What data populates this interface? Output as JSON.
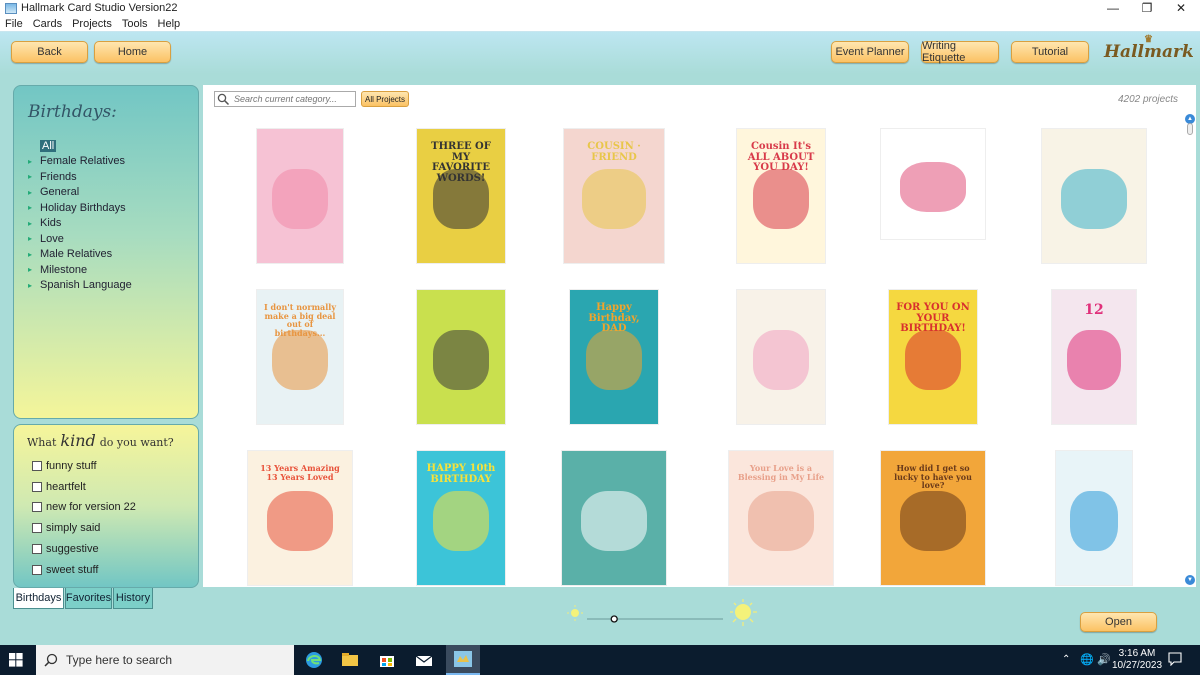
{
  "window": {
    "title": "Hallmark Card Studio Version22",
    "controls": {
      "minimize": "—",
      "maximize": "❐",
      "close": "✕"
    }
  },
  "menu": [
    "File",
    "Cards",
    "Projects",
    "Tools",
    "Help"
  ],
  "toolbar": {
    "back": "Back",
    "home": "Home",
    "event_planner": "Event Planner",
    "writing_etiquette": "Writing Etiquette",
    "tutorial": "Tutorial",
    "logo": "Hallmark"
  },
  "categories": {
    "title": "Birthdays:",
    "items": [
      "All",
      "Female Relatives",
      "Friends",
      "General",
      "Holiday Birthdays",
      "Kids",
      "Love",
      "Male Relatives",
      "Milestone",
      "Spanish Language"
    ],
    "selected": "All"
  },
  "kind": {
    "prefix": "What",
    "word": "kind",
    "suffix": "do you want?",
    "options": [
      "funny stuff",
      "heartfelt",
      "new for version 22",
      "simply said",
      "suggestive",
      "sweet stuff"
    ]
  },
  "left_tabs": [
    "Birthdays",
    "Favorites",
    "History"
  ],
  "main": {
    "search_placeholder": "Search current category...",
    "all_projects": "All Projects",
    "count_label": "4202  projects"
  },
  "cards": [
    {
      "text": "",
      "bg": "#f6c2d4",
      "accent": "#f08aa8"
    },
    {
      "text": "THREE OF MY FAVORITE WORDS!",
      "bg": "#e9cf43",
      "accent": "#333333"
    },
    {
      "text": "COUSIN · FRIEND",
      "bg": "#f4d6cf",
      "accent": "#e8c64a"
    },
    {
      "text": "Cousin It's ALL ABOUT YOU DAY!",
      "bg": "#fff6dc",
      "accent": "#d83a4a"
    },
    {
      "text": "",
      "bg": "#ffffff",
      "accent": "#e0507a"
    },
    {
      "text": "",
      "bg": "#f8f3e6",
      "accent": "#3ab0c8"
    },
    {
      "text": "I don't normally make a big deal out of birthdays...",
      "bg": "#e8f2f4",
      "accent": "#e89540"
    },
    {
      "text": "",
      "bg": "#c9e04e",
      "accent": "#3a3a3a"
    },
    {
      "text": "Happy Birthday, DAD",
      "bg": "#2aa6b0",
      "accent": "#f1a42b"
    },
    {
      "text": "",
      "bg": "#f8f2e8",
      "accent": "#f0a0c0"
    },
    {
      "text": "FOR YOU ON YOUR BIRTHDAY!",
      "bg": "#f5d840",
      "accent": "#d8302e"
    },
    {
      "text": "12",
      "bg": "#f4e6ee",
      "accent": "#e0307a"
    },
    {
      "text": "13 Years Amazing 13 Years Loved",
      "bg": "#fbf1e0",
      "accent": "#e8523a"
    },
    {
      "text": "HAPPY 10th BIRTHDAY",
      "bg": "#3cc4d8",
      "accent": "#f7e23a"
    },
    {
      "text": "",
      "bg": "#5ab0a8",
      "accent": "#ffffff"
    },
    {
      "text": "Your Love is a Blessing in My Life",
      "bg": "#fbe6dc",
      "accent": "#e8a08a"
    },
    {
      "text": "How did I get so lucky to have you love?",
      "bg": "#f2a63a",
      "accent": "#6a3a1a"
    },
    {
      "text": "",
      "bg": "#e8f4f8",
      "accent": "#2a9ad8"
    }
  ],
  "zoom": {
    "level": 0.2
  },
  "open_button": "Open",
  "taskbar": {
    "search_placeholder": "Type here to search",
    "time": "3:16 AM",
    "date": "10/27/2023"
  }
}
